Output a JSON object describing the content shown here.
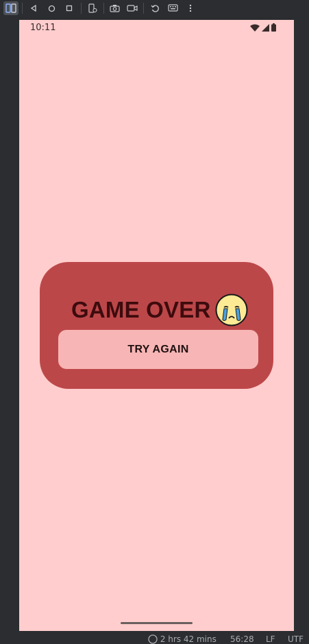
{
  "toolbar": {
    "icons": [
      "device-mirror-icon",
      "back-icon",
      "home-icon",
      "overview-icon",
      "device-settings-icon",
      "camera-icon",
      "screen-record-icon",
      "rotate-icon",
      "keyboard-icon",
      "more-icon"
    ]
  },
  "status_bar": {
    "time": "10:11"
  },
  "game_over": {
    "title": "GAME OVER",
    "emoji": "crying-face-icon",
    "button_label": "TRY AGAIN"
  },
  "ide_status": {
    "timer": "2 hrs 42 mins",
    "position": "56:28",
    "line_ending": "LF",
    "encoding": "UTF"
  },
  "colors": {
    "screen_bg": "#ffcdcd",
    "card_bg": "#bc4749",
    "button_bg": "#f7b5b5",
    "title_text": "#3d0b0d"
  }
}
